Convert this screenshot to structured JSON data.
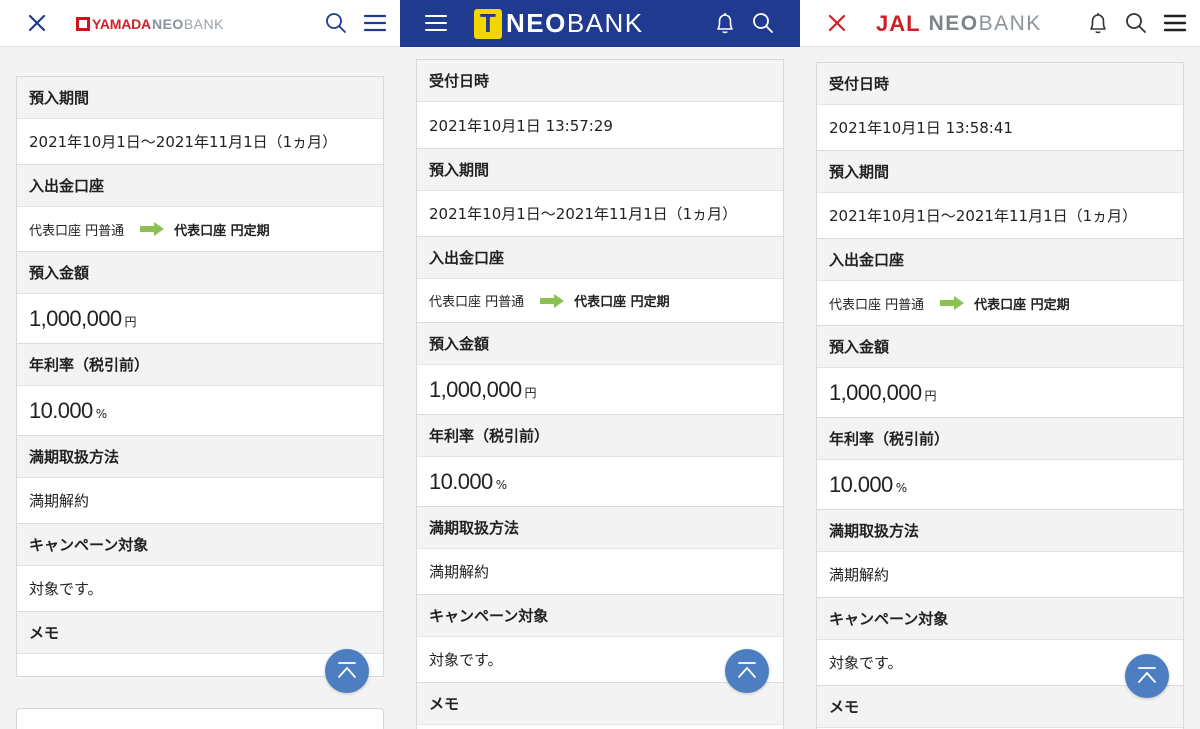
{
  "panels": [
    {
      "brand": "YAMADA",
      "logo_neo": "NEO",
      "logo_bank": "BANK",
      "sections": [
        {
          "label": "預入期間",
          "value": "2021年10月1日〜2021年11月1日（1ヵ月）",
          "kind": "text"
        },
        {
          "label": "入出金口座",
          "from": "代表口座 円普通",
          "to": "代表口座 円定期",
          "kind": "account"
        },
        {
          "label": "預入金額",
          "number": "1,000,000",
          "unit": "円",
          "kind": "number"
        },
        {
          "label": "年利率（税引前）",
          "number": "10.000",
          "unit": "%",
          "kind": "number"
        },
        {
          "label": "満期取扱方法",
          "value": "満期解約",
          "kind": "text"
        },
        {
          "label": "キャンペーン対象",
          "value": "対象です。",
          "kind": "text"
        },
        {
          "label": "メモ",
          "value": "",
          "kind": "text"
        }
      ]
    },
    {
      "brand": "T",
      "logo_neo": "NEO",
      "logo_bank": "BANK",
      "sections": [
        {
          "label": "受付日時",
          "value": "2021年10月1日 13:57:29",
          "kind": "text"
        },
        {
          "label": "預入期間",
          "value": "2021年10月1日〜2021年11月1日（1ヵ月）",
          "kind": "text"
        },
        {
          "label": "入出金口座",
          "from": "代表口座 円普通",
          "to": "代表口座 円定期",
          "kind": "account"
        },
        {
          "label": "預入金額",
          "number": "1,000,000",
          "unit": "円",
          "kind": "number"
        },
        {
          "label": "年利率（税引前）",
          "number": "10.000",
          "unit": "%",
          "kind": "number"
        },
        {
          "label": "満期取扱方法",
          "value": "満期解約",
          "kind": "text"
        },
        {
          "label": "キャンペーン対象",
          "value": "対象です。",
          "kind": "text"
        },
        {
          "label": "メモ",
          "value": "",
          "kind": "text"
        }
      ]
    },
    {
      "brand": "JAL",
      "logo_neo": "NEO",
      "logo_bank": "BANK",
      "sections": [
        {
          "label": "受付日時",
          "value": "2021年10月1日 13:58:41",
          "kind": "text"
        },
        {
          "label": "預入期間",
          "value": "2021年10月1日〜2021年11月1日（1ヵ月）",
          "kind": "text"
        },
        {
          "label": "入出金口座",
          "from": "代表口座 円普通",
          "to": "代表口座 円定期",
          "kind": "account"
        },
        {
          "label": "預入金額",
          "number": "1,000,000",
          "unit": "円",
          "kind": "number"
        },
        {
          "label": "年利率（税引前）",
          "number": "10.000",
          "unit": "%",
          "kind": "number"
        },
        {
          "label": "満期取扱方法",
          "value": "満期解約",
          "kind": "text"
        },
        {
          "label": "キャンペーン対象",
          "value": "対象です。",
          "kind": "text"
        },
        {
          "label": "メモ",
          "value": "",
          "kind": "text"
        }
      ]
    }
  ],
  "icons": {
    "close": "close-icon",
    "menu": "hamburger-menu-icon",
    "search": "search-icon",
    "bell": "bell-icon",
    "scroll_top": "scroll-to-top-icon",
    "arrow": "right-arrow-icon"
  },
  "colors": {
    "yamada_red": "#d2202a",
    "t_navy": "#1f3a8f",
    "t_yellow": "#f5d500",
    "jal_red": "#cc1f26",
    "accent_blue": "#4e7ec2",
    "arrow_green": "#8cc152"
  }
}
